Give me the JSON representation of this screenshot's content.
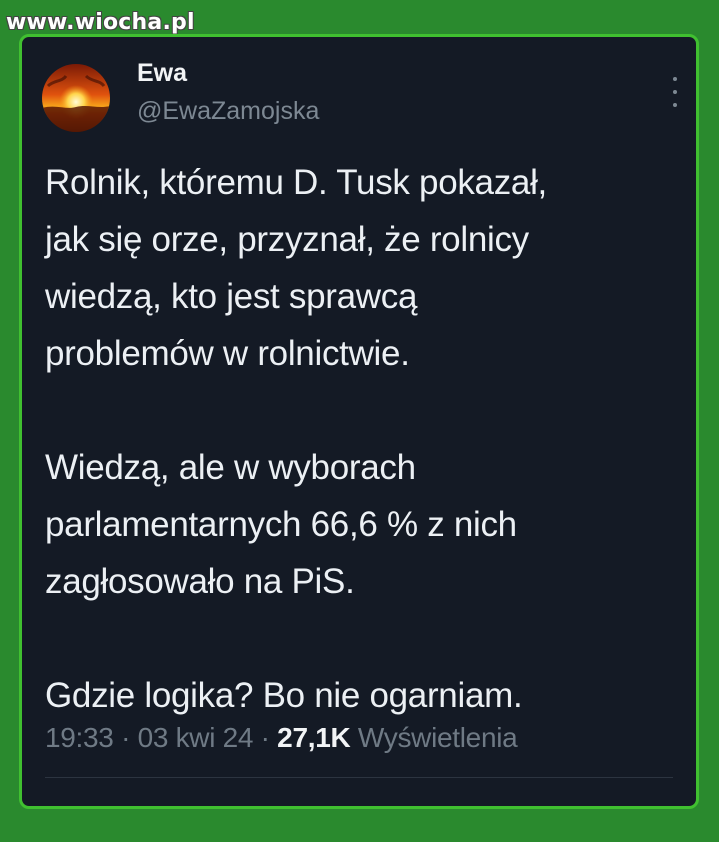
{
  "watermark": "www.wiocha.pl",
  "tweet": {
    "author": {
      "name": "Ewa",
      "handle": "@EwaZamojska"
    },
    "paragraphs": [
      "Rolnik, któremu D. Tusk pokazał,\njak się orze, przyznał, że rolnicy\nwiedzą, kto jest sprawcą\nproblemów w rolnictwie.",
      "Wiedzą, ale w wyborach\nparlamentarnych 66,6 % z nich\nzagłosowało na PiS.",
      "Gdzie logika? Bo nie ogarniam."
    ],
    "meta": {
      "time": "19:33",
      "separator": "·",
      "date": "03 kwi 24",
      "views_count": "27,1K",
      "views_label": "Wyświetlenia"
    }
  },
  "icons": {
    "more": "more-vertical-icon",
    "avatar": "sunset-avatar"
  },
  "colors": {
    "page_background": "#2a8a2e",
    "card_background": "#141a25",
    "card_border": "#40c030",
    "text_primary": "#ecf0f4",
    "text_secondary": "#7d8893"
  }
}
